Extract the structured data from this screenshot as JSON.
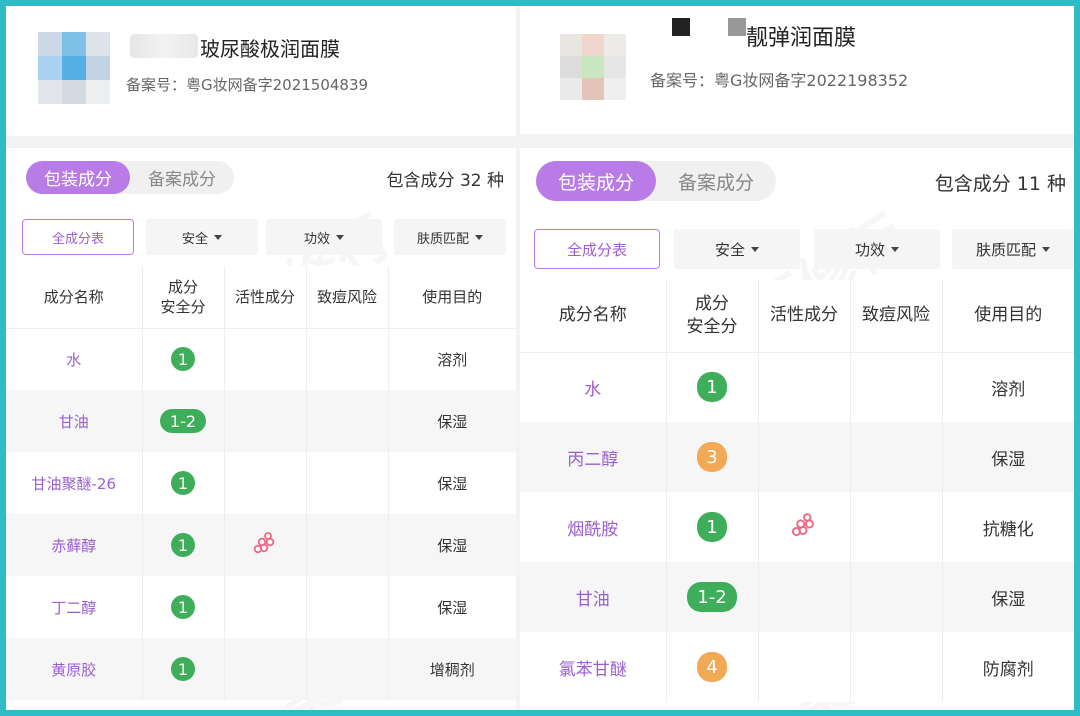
{
  "watermark": "美丽修行",
  "colors": {
    "accent": "#b97ce6",
    "safe": "#3fae5a",
    "risk": "#f2a956",
    "highlight": "#e02424"
  },
  "panels": [
    {
      "title_suffix": "玻尿酸极润面膜",
      "registration": "备案号：粤G妆网备字2021504839",
      "tabs": [
        {
          "label": "包装成分",
          "active": true
        },
        {
          "label": "备案成分",
          "active": false
        }
      ],
      "count_label": "包含成分 32 种",
      "filters": [
        {
          "label": "全成分表",
          "type": "outline"
        },
        {
          "label": "安全",
          "type": "dropdown"
        },
        {
          "label": "功效",
          "type": "dropdown"
        },
        {
          "label": "肤质匹配",
          "type": "dropdown"
        }
      ],
      "headers": [
        "成分名称",
        "成分\n安全分",
        "活性成分",
        "致痘风险",
        "使用目的"
      ],
      "rows": [
        {
          "name": "水",
          "score": "1",
          "score_color": "green",
          "active_icon": false,
          "purpose": "溶剂"
        },
        {
          "name": "甘油",
          "score": "1-2",
          "score_color": "green",
          "active_icon": false,
          "purpose": "保湿"
        },
        {
          "name": "甘油聚醚-26",
          "score": "1",
          "score_color": "green",
          "active_icon": false,
          "purpose": "保湿"
        },
        {
          "name": "赤藓醇",
          "score": "1",
          "score_color": "green",
          "active_icon": true,
          "purpose": "保湿"
        },
        {
          "name": "丁二醇",
          "score": "1",
          "score_color": "green",
          "active_icon": false,
          "purpose": "保湿"
        },
        {
          "name": "黄原胶",
          "score": "1",
          "score_color": "green",
          "active_icon": false,
          "purpose": "增稠剂",
          "highlighted": true
        }
      ]
    },
    {
      "title_suffix": "靓弹润面膜",
      "registration": "备案号：粤G妆网备字2022198352",
      "tabs": [
        {
          "label": "包装成分",
          "active": true
        },
        {
          "label": "备案成分",
          "active": false
        }
      ],
      "count_label": "包含成分 11 种",
      "filters": [
        {
          "label": "全成分表",
          "type": "outline"
        },
        {
          "label": "安全",
          "type": "dropdown"
        },
        {
          "label": "功效",
          "type": "dropdown"
        },
        {
          "label": "肤质匹配",
          "type": "dropdown"
        }
      ],
      "headers": [
        "成分名称",
        "成分\n安全分",
        "活性成分",
        "致痘风险",
        "使用目的"
      ],
      "rows": [
        {
          "name": "水",
          "score": "1",
          "score_color": "green",
          "active_icon": false,
          "purpose": "溶剂"
        },
        {
          "name": "丙二醇",
          "score": "3",
          "score_color": "orange",
          "active_icon": false,
          "purpose": "保湿"
        },
        {
          "name": "烟酰胺",
          "score": "1",
          "score_color": "green",
          "active_icon": true,
          "purpose": "抗糖化"
        },
        {
          "name": "甘油",
          "score": "1-2",
          "score_color": "green",
          "active_icon": false,
          "purpose": "保湿"
        },
        {
          "name": "氯苯甘醚",
          "score": "4",
          "score_color": "orange",
          "active_icon": false,
          "purpose": "防腐剂",
          "highlighted": true
        }
      ]
    }
  ]
}
